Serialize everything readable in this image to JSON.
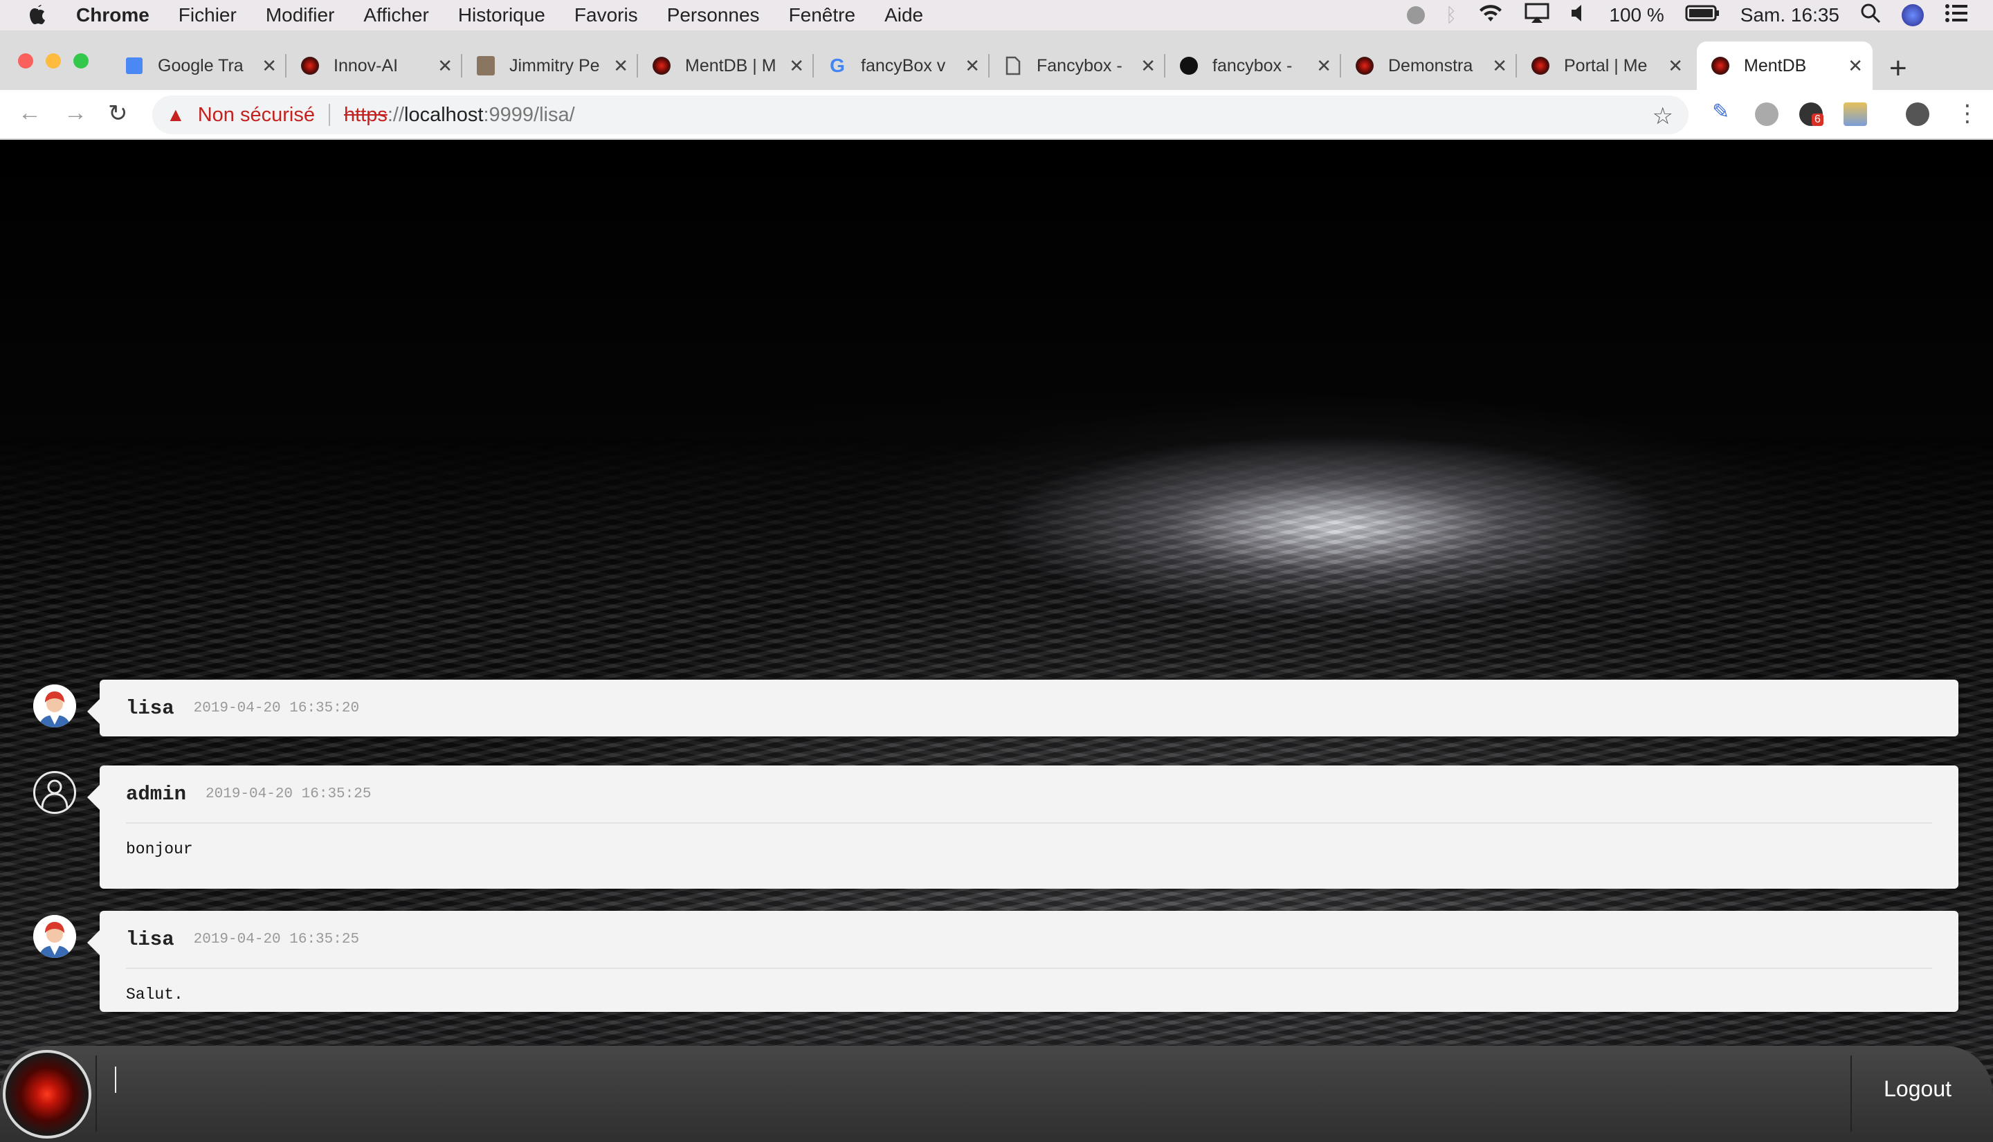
{
  "menubar": {
    "app": "Chrome",
    "items": [
      "Fichier",
      "Modifier",
      "Afficher",
      "Historique",
      "Favoris",
      "Personnes",
      "Fenêtre",
      "Aide"
    ],
    "battery": "100 %",
    "clock": "Sam. 16:35"
  },
  "tabs": [
    {
      "title": "Google Tra"
    },
    {
      "title": "Innov-AI"
    },
    {
      "title": "Jimmitry Pe"
    },
    {
      "title": "MentDB | M"
    },
    {
      "title": "fancyBox v"
    },
    {
      "title": "Fancybox -"
    },
    {
      "title": "fancybox -"
    },
    {
      "title": "Demonstra"
    },
    {
      "title": "Portal | Me"
    },
    {
      "title": "MentDB"
    }
  ],
  "addressbar": {
    "security_label": "Non sécurisé",
    "scheme": "https",
    "sep": "://",
    "host": "localhost",
    "rest": ":9999/lisa/",
    "extension_badge": "6"
  },
  "messages": [
    {
      "user": "lisa",
      "time": "2019-04-20 16:35:20",
      "text": ""
    },
    {
      "user": "admin",
      "time": "2019-04-20 16:35:25",
      "text": "bonjour"
    },
    {
      "user": "lisa",
      "time": "2019-04-20 16:35:25",
      "text": "Salut."
    }
  ],
  "input": {
    "value": ""
  },
  "logout_label": "Logout"
}
